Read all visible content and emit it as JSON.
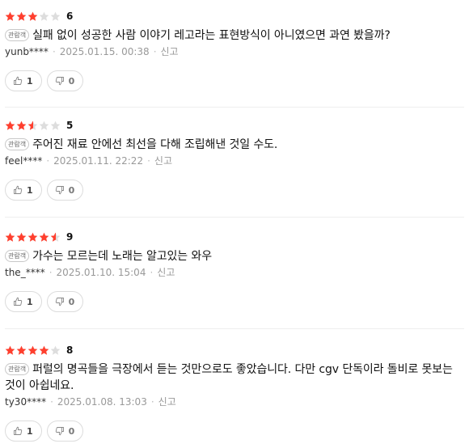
{
  "colors": {
    "star_on": "#ff3f2e",
    "star_off": "#dddddd",
    "border": "#dcdcdc"
  },
  "icons": {
    "star": "star-icon",
    "like": "thumbs-up-icon",
    "dislike": "thumbs-down-icon"
  },
  "reviews": [
    {
      "rating_stars": 3,
      "score": "6",
      "badge": "관람객",
      "text": "실패 없이 성공한 사람 이야기 레고라는 표현방식이 아니였으면 과연 봤을까?",
      "user": "yunb****",
      "date": "2025.01.15. 00:38",
      "report": "신고",
      "likes": "1",
      "dislikes": "0"
    },
    {
      "rating_stars": 2.5,
      "score": "5",
      "badge": "관람객",
      "text": "주어진 재료 안에선 최선을 다해 조립해낸 것일 수도.",
      "user": "feel****",
      "date": "2025.01.11. 22:22",
      "report": "신고",
      "likes": "1",
      "dislikes": "0"
    },
    {
      "rating_stars": 4.5,
      "score": "9",
      "badge": "관람객",
      "text": "가수는 모르는데 노래는 알고있는 와우",
      "user": "the_****",
      "date": "2025.01.10. 15:04",
      "report": "신고",
      "likes": "1",
      "dislikes": "0"
    },
    {
      "rating_stars": 4,
      "score": "8",
      "badge": "관람객",
      "text": "퍼럴의 명곡들을 극장에서 듣는 것만으로도 좋았습니다. 다만 cgv 단독이라 돌비로 못보는 것이 아쉽네요.",
      "user": "ty30****",
      "date": "2025.01.08. 13:03",
      "report": "신고",
      "likes": "1",
      "dislikes": "0"
    }
  ]
}
